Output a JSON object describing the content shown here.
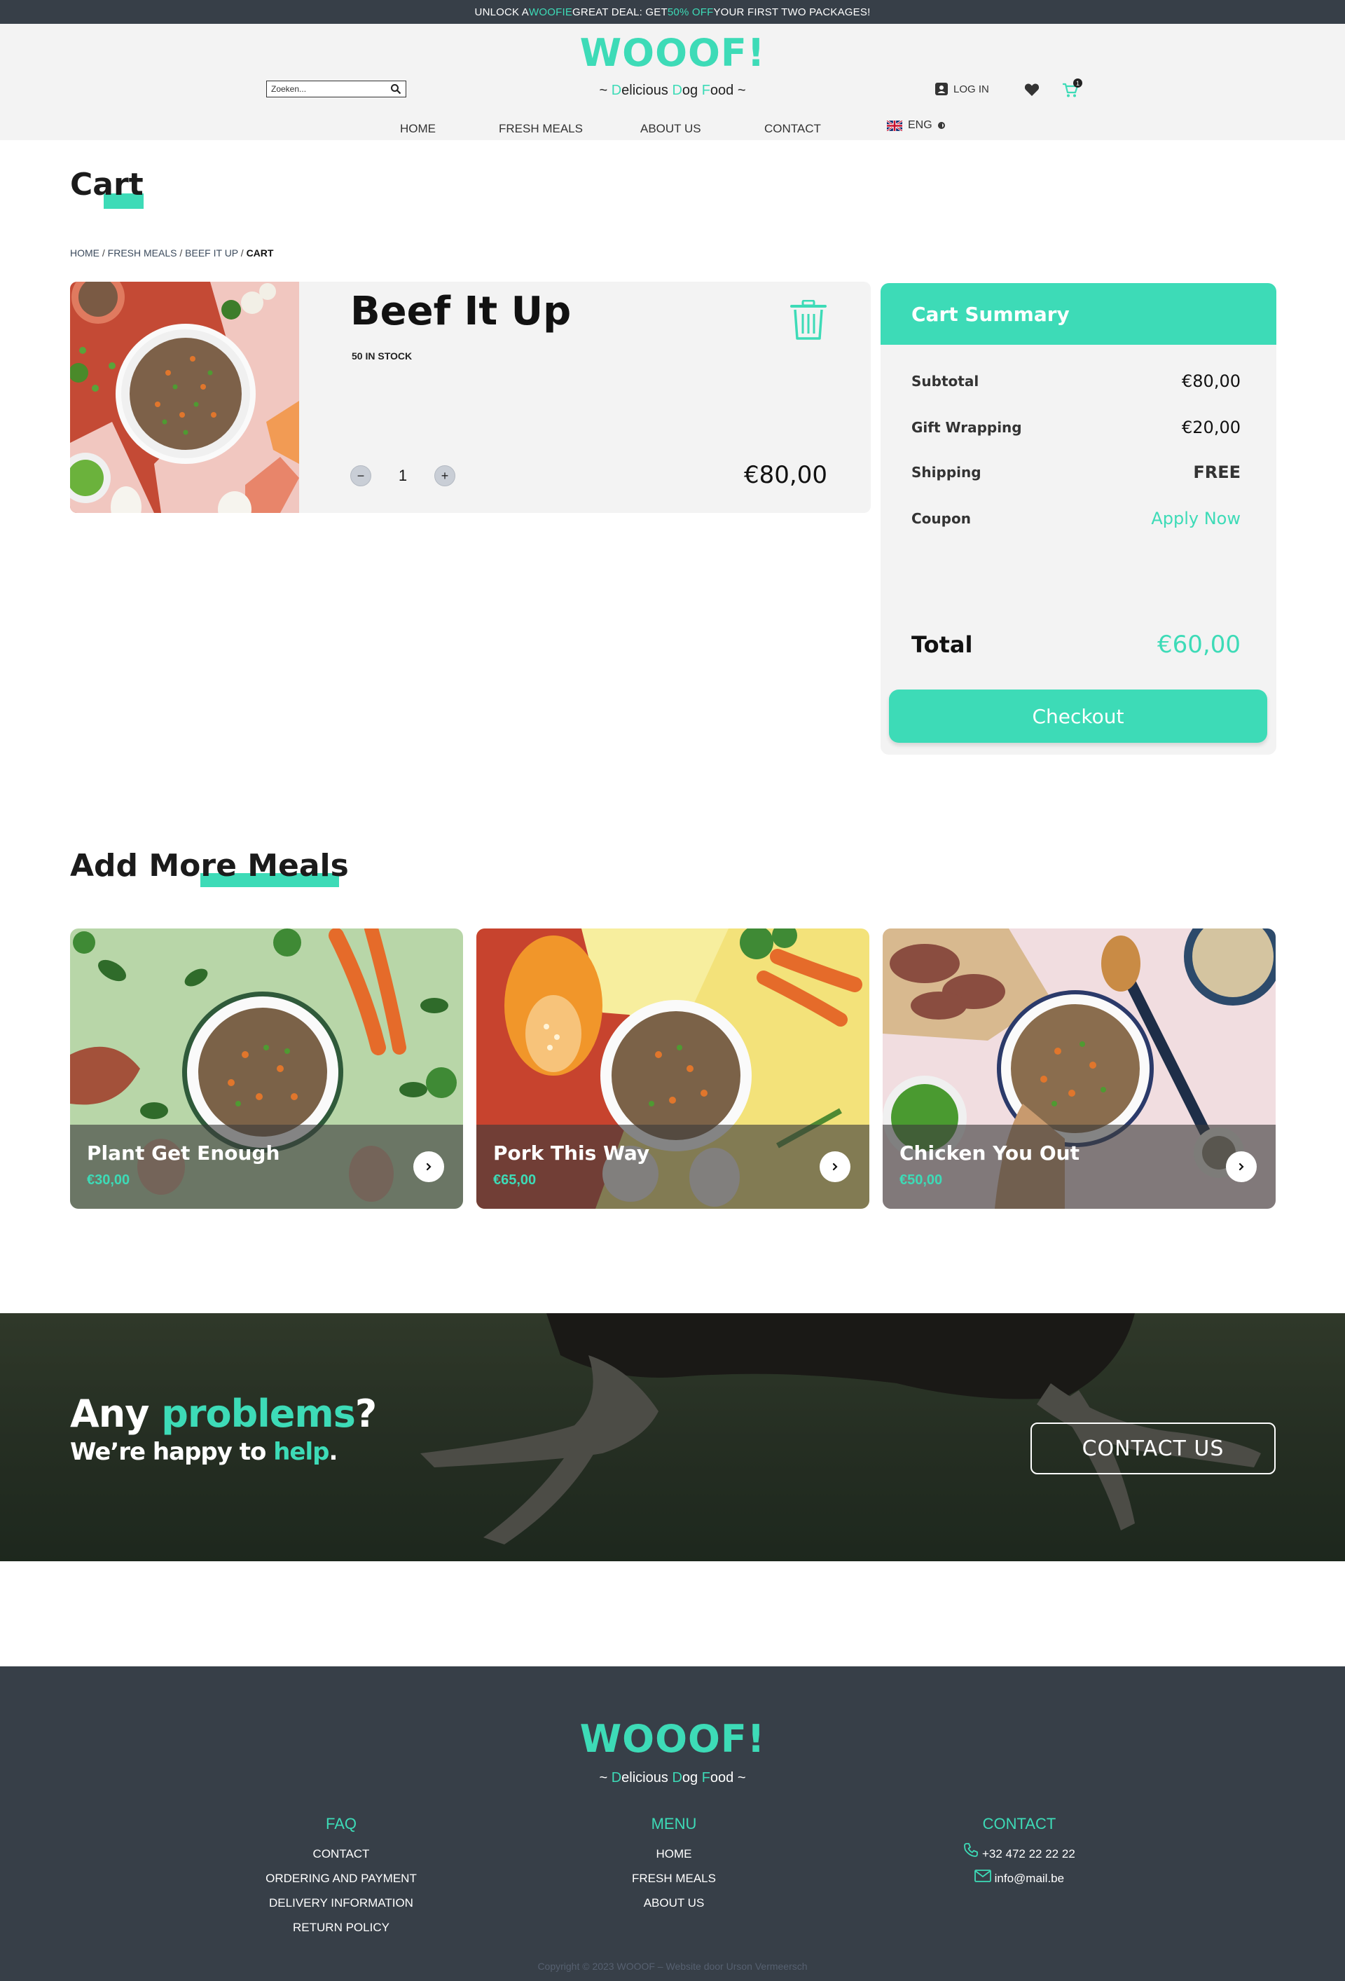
{
  "promo": {
    "pre": "UNLOCK A ",
    "brand": "WOOFIE",
    "mid": " GREAT DEAL: GET ",
    "deal": "50% OFF",
    "post": " YOUR FIRST TWO PACKAGES!"
  },
  "header": {
    "logo": "WOOOF!",
    "tagline": {
      "p1": "~ ",
      "d": "D",
      "p2": "elicious ",
      "d2": "D",
      "p3": "og ",
      "f": "F",
      "p4": "ood ~"
    },
    "search_placeholder": "Zoeken...",
    "login": "LOG IN",
    "cart_count": "1",
    "language": "ENG"
  },
  "nav": [
    "HOME",
    "FRESH MEALS",
    "ABOUT US",
    "CONTACT"
  ],
  "page_title": "Cart",
  "breadcrumb": {
    "home": "HOME",
    "meals": "FRESH MEALS",
    "product": "BEEF IT UP",
    "current": "CART",
    "sep": " / "
  },
  "cart_item": {
    "name": "Beef It Up",
    "stock": "50 IN STOCK",
    "qty_minus": "−",
    "qty": "1",
    "qty_plus": "+",
    "price": "€80,00"
  },
  "summary": {
    "title": "Cart Summary",
    "rows": [
      {
        "label": "Subtotal",
        "value": "€80,00"
      },
      {
        "label": "Gift Wrapping",
        "value": "€20,00"
      },
      {
        "label": "Shipping",
        "value": "FREE"
      },
      {
        "label": "Coupon",
        "value": "Apply Now"
      }
    ],
    "total_label": "Total",
    "total_value": "€60,00",
    "checkout": "Checkout"
  },
  "more_title": "Add More Meals",
  "meals": [
    {
      "name": "Plant Get Enough",
      "price": "€30,00"
    },
    {
      "name": "Pork This Way",
      "price": "€65,00"
    },
    {
      "name": "Chicken You Out",
      "price": "€50,00"
    }
  ],
  "banner": {
    "a1": "Any ",
    "a2": "problems",
    "a3": "?",
    "b1": "We’re happy to ",
    "b2": "help",
    "b3": ".",
    "button": "CONTACT US"
  },
  "footer": {
    "logo": "WOOOF!",
    "faq": {
      "title": "FAQ",
      "links": [
        "CONTACT",
        "ORDERING AND PAYMENT",
        "DELIVERY INFORMATION",
        "RETURN POLICY"
      ]
    },
    "menu": {
      "title": "MENU",
      "links": [
        "HOME",
        "FRESH MEALS",
        "ABOUT US"
      ]
    },
    "contact": {
      "title": "CONTACT",
      "phone": "+32 472 22 22 22",
      "email": "info@mail.be"
    },
    "copyright": "Copyright © 2023 WOOOF –  Website door Urson Vermeersch"
  },
  "colors": {
    "accent": "#3ddbb7",
    "dark": "#373f48",
    "panel": "#f3f3f3"
  },
  "icons": [
    "search-icon",
    "user-icon",
    "heart-icon",
    "cart-icon",
    "uk-flag-icon",
    "trash-icon",
    "chevron-right-icon",
    "phone-icon",
    "mail-icon"
  ]
}
